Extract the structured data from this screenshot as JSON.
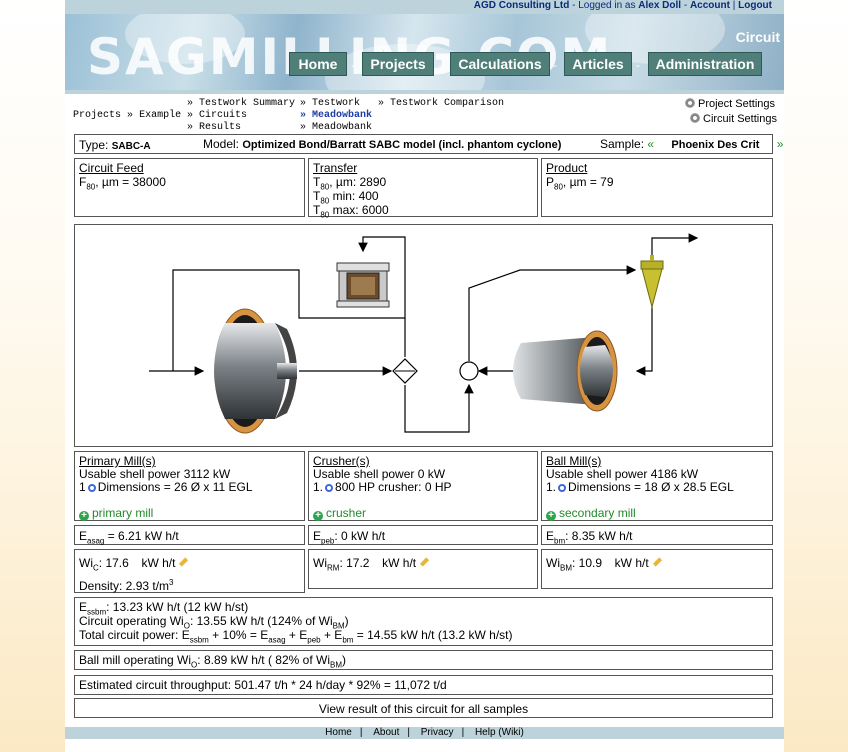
{
  "topbar": {
    "company": "AGD Consulting Ltd",
    "logged_prefix": "Logged in as",
    "user": "Alex Doll",
    "account": "Account",
    "logout": "Logout"
  },
  "banner": {
    "logo": "SAGMILLING.COM",
    "section_title": "Circuit"
  },
  "nav": {
    "home": "Home",
    "projects": "Projects",
    "calculations": "Calculations",
    "articles": "Articles",
    "administration": "Administration"
  },
  "breadcrumb": {
    "projects": "Projects",
    "sep": "»",
    "example": "Example",
    "col1": [
      "» Testwork Summary",
      "» Circuits",
      "» Results"
    ],
    "col2": [
      "» Testwork",
      "» Meadowbank",
      "» Meadowbank"
    ],
    "col3": "» Testwork Comparison"
  },
  "settings": {
    "project": "Project Settings",
    "circuit": "Circuit Settings"
  },
  "info": {
    "type_label": "Type:",
    "type_value": "SABC-A",
    "model_label": "Model:",
    "model_value": "Optimized Bond/Barratt SABC model (incl. phantom cyclone)",
    "sample_label": "Sample:",
    "sample_prev": "«",
    "sample_value": "Phoenix Des Crit",
    "sample_next": "»"
  },
  "circuit_feed": {
    "title": "Circuit Feed",
    "f_sub": "80",
    "f_rest": ", µm = 38000"
  },
  "transfer": {
    "title": "Transfer",
    "t_sub": "80",
    "l1": ", µm: 2890",
    "l2": " min: 400",
    "l3": " max: 6000"
  },
  "product": {
    "title": "Product",
    "p_sub": "80",
    "rest": ", µm = 79"
  },
  "primary": {
    "title": "Primary Mill(s)",
    "power": "Usable shell power 3112 kW",
    "num": "1",
    "dims": "Dimensions = 26 Ø x 11 EGL",
    "link": "primary mill"
  },
  "crusher": {
    "title": "Crusher(s)",
    "power": "Usable shell power 0 kW",
    "num": "1.",
    "dims": "800 HP crusher: 0 HP",
    "link": "crusher"
  },
  "ballmill": {
    "title": "Ball Mill(s)",
    "power": "Usable shell power 4186 kW",
    "num": "1.",
    "dims": "Dimensions = 18 Ø x 28.5 EGL",
    "link": "secondary mill"
  },
  "energy": {
    "asag_sub": "asag",
    "asag_val": " = 6.21 kW h/t",
    "peb_sub": "peb",
    "peb_val": ": 0 kW h/t",
    "bm_sub": "bm",
    "bm_val": ": 8.35 kW h/t"
  },
  "wi": {
    "wic_sub": "C",
    "wic_val": "17.6",
    "unit": "kW h/t",
    "density": "Density: 2.93 t/m",
    "rm_sub": "RM",
    "rm_val": "17.2",
    "bm_sub": "BM",
    "bm_val": "10.9"
  },
  "summary": {
    "l1_sub": "ssbm",
    "l1": ": 13.23 kW h/t (12 kW h/st)",
    "l2a": "Circuit operating Wi",
    "l2_sub": "O",
    "l2b": ": 13.55 kW h/t (124% of Wi",
    "l2_sub2": "BM",
    "l2c": ")",
    "l3a": "Total circuit power: E",
    "l3s1": "ssbm",
    "l3b": " + 10% = E",
    "l3s2": "asag",
    "l3c": " + E",
    "l3s3": "peb",
    "l3d": " + E",
    "l3s4": "bm",
    "l3e": " = 14.55 kW h/t (13.2 kW h/st)"
  },
  "ballop": {
    "a": "Ball mill operating Wi",
    "sub": "O",
    "b": ": 8.89 kW h/t ( 82% of Wi",
    "sub2": "BM",
    "c": ")"
  },
  "throughput": "Estimated circuit throughput: 501.47 t/h * 24 h/day * 92% = 11,072 t/d",
  "view_all": "View result of this circuit for all samples",
  "footer": [
    "Home",
    "About",
    "Privacy",
    "Help (Wiki)"
  ]
}
